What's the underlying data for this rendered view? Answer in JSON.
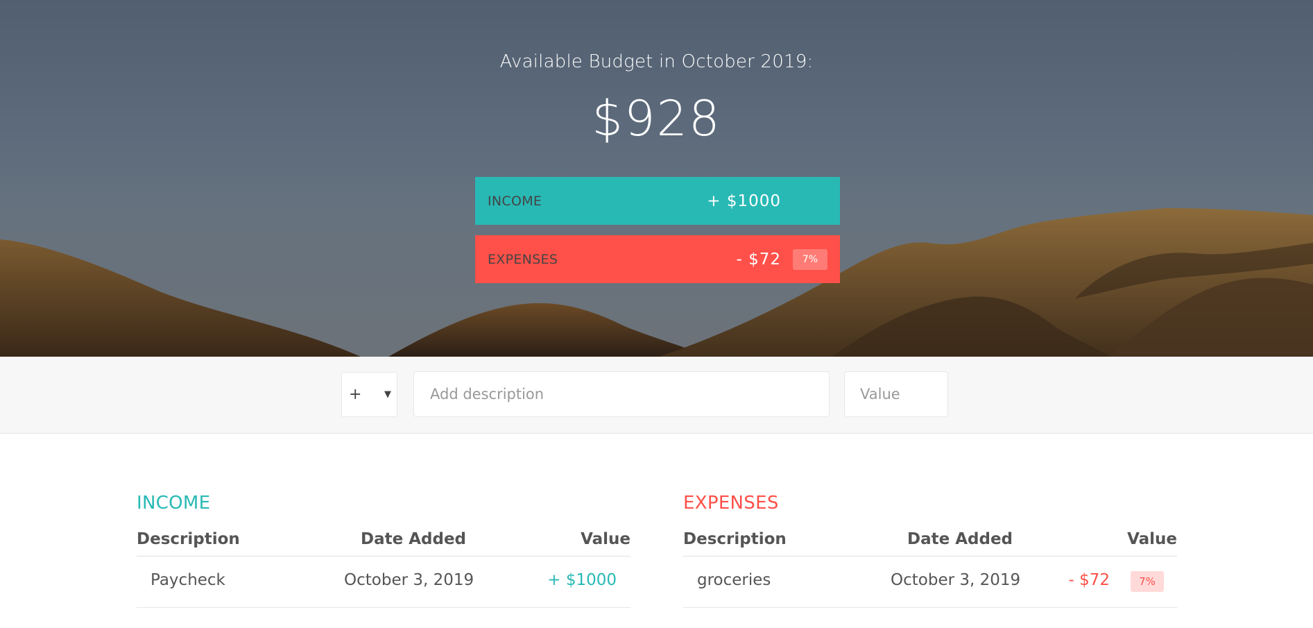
{
  "budget": {
    "title": "Available Budget in October 2019:",
    "value": "$928"
  },
  "summary": {
    "income_label": "Income",
    "income_value": "+ $1000",
    "expenses_label": "Expenses",
    "expenses_value": "- $72",
    "expenses_percentage": "7%"
  },
  "add": {
    "type_value": "+",
    "description_placeholder": "Add description",
    "value_placeholder": "Value"
  },
  "lists": {
    "income": {
      "title": "Income",
      "headers": {
        "description": "Description",
        "date": "Date Added",
        "value": "Value"
      },
      "items": [
        {
          "description": "Paycheck",
          "date": "October 3, 2019",
          "value": "+ $1000"
        }
      ]
    },
    "expenses": {
      "title": "Expenses",
      "headers": {
        "description": "Description",
        "date": "Date Added",
        "value": "Value"
      },
      "items": [
        {
          "description": "groceries",
          "date": "October 3, 2019",
          "value": "- $72",
          "percentage": "7%"
        }
      ]
    }
  },
  "colors": {
    "income": "#28b9b5",
    "expenses": "#ff5049",
    "background_panel": "#f7f7f7"
  },
  "icons": {
    "type_select_arrow": "triangle-down-icon"
  }
}
